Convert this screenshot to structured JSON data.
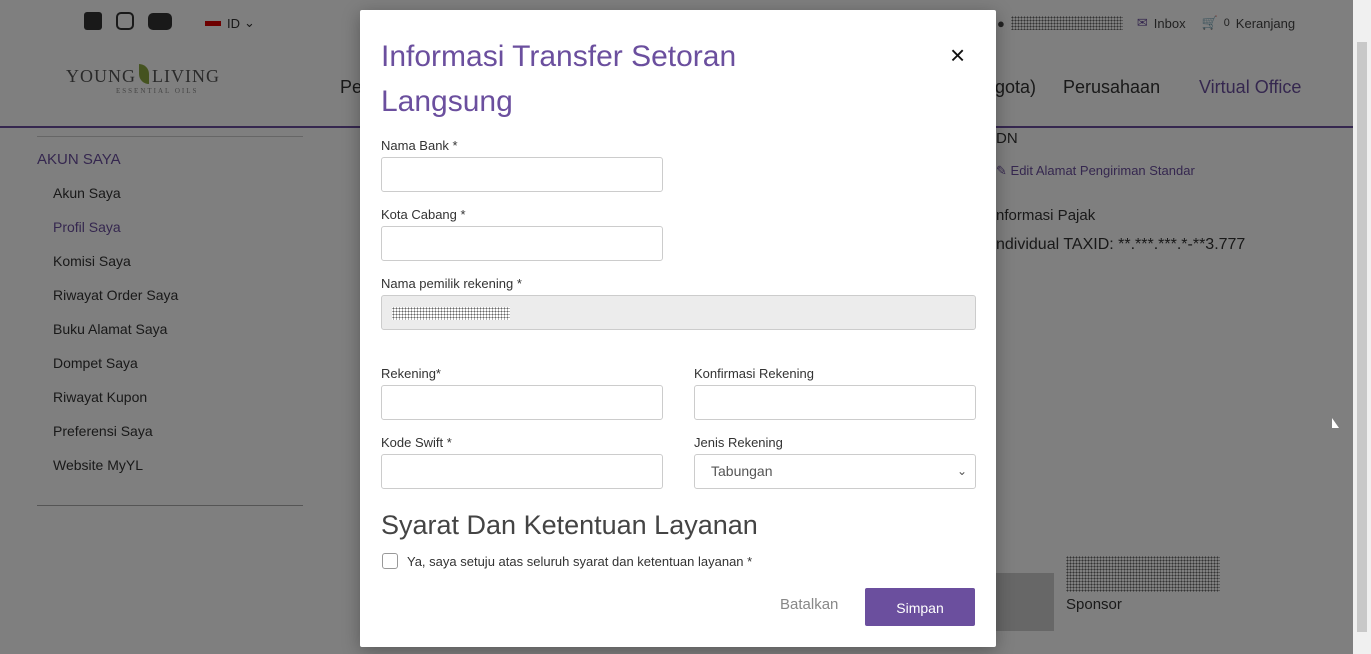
{
  "topbar": {
    "language": "ID",
    "inbox_label": "Inbox",
    "cart_count": "0",
    "cart_label": "Keranjang",
    "icons": [
      "facebook-icon",
      "instagram-icon",
      "youtube-icon",
      "user-icon",
      "mail-icon",
      "cart-icon"
    ]
  },
  "header": {
    "logo_main": "YOUNG LIVING",
    "logo_sub": "ESSENTIAL OILS",
    "nav": [
      "Pe",
      "gota)",
      "Perusahaan",
      "Virtual Office"
    ]
  },
  "sidebar": {
    "heading": "AKUN SAYA",
    "items": [
      {
        "label": "Akun Saya"
      },
      {
        "label": "Profil Saya"
      },
      {
        "label": "Komisi Saya"
      },
      {
        "label": "Riwayat Order Saya"
      },
      {
        "label": "Buku Alamat Saya"
      },
      {
        "label": "Dompet Saya"
      },
      {
        "label": "Riwayat Kupon"
      },
      {
        "label": "Preferensi Saya"
      },
      {
        "label": "Website MyYL"
      }
    ]
  },
  "background_content": {
    "dn": "DN",
    "edit_link": "Edit Alamat Pengiriman Standar",
    "tax_heading": "nformasi Pajak",
    "tax_value": "ndividual TAXID: **.***.***.*-**3.777",
    "sponsor_label": "Sponsor"
  },
  "modal": {
    "title": "Informasi Transfer Setoran Langsung",
    "close_glyph": "×",
    "fields": {
      "bank_name": {
        "label": "Nama Bank *",
        "value": ""
      },
      "branch_city": {
        "label": "Kota Cabang *",
        "value": ""
      },
      "account_owner": {
        "label": "Nama pemilik rekening *"
      },
      "account": {
        "label": "Rekening*",
        "value": ""
      },
      "confirm_account": {
        "label": "Konfirmasi Rekening",
        "value": ""
      },
      "swift_code": {
        "label": "Kode Swift *",
        "value": ""
      },
      "account_type": {
        "label": "Jenis Rekening",
        "selected": "Tabungan"
      }
    },
    "terms_heading": "Syarat Dan Ketentuan Layanan",
    "terms_checkbox_label": "Ya, saya setuju atas seluruh syarat dan ketentuan layanan *",
    "cancel_label": "Batalkan",
    "save_label": "Simpan"
  },
  "colors": {
    "accent": "#6b4f9e",
    "overlay": "rgba(0,0,0,0.5)"
  }
}
